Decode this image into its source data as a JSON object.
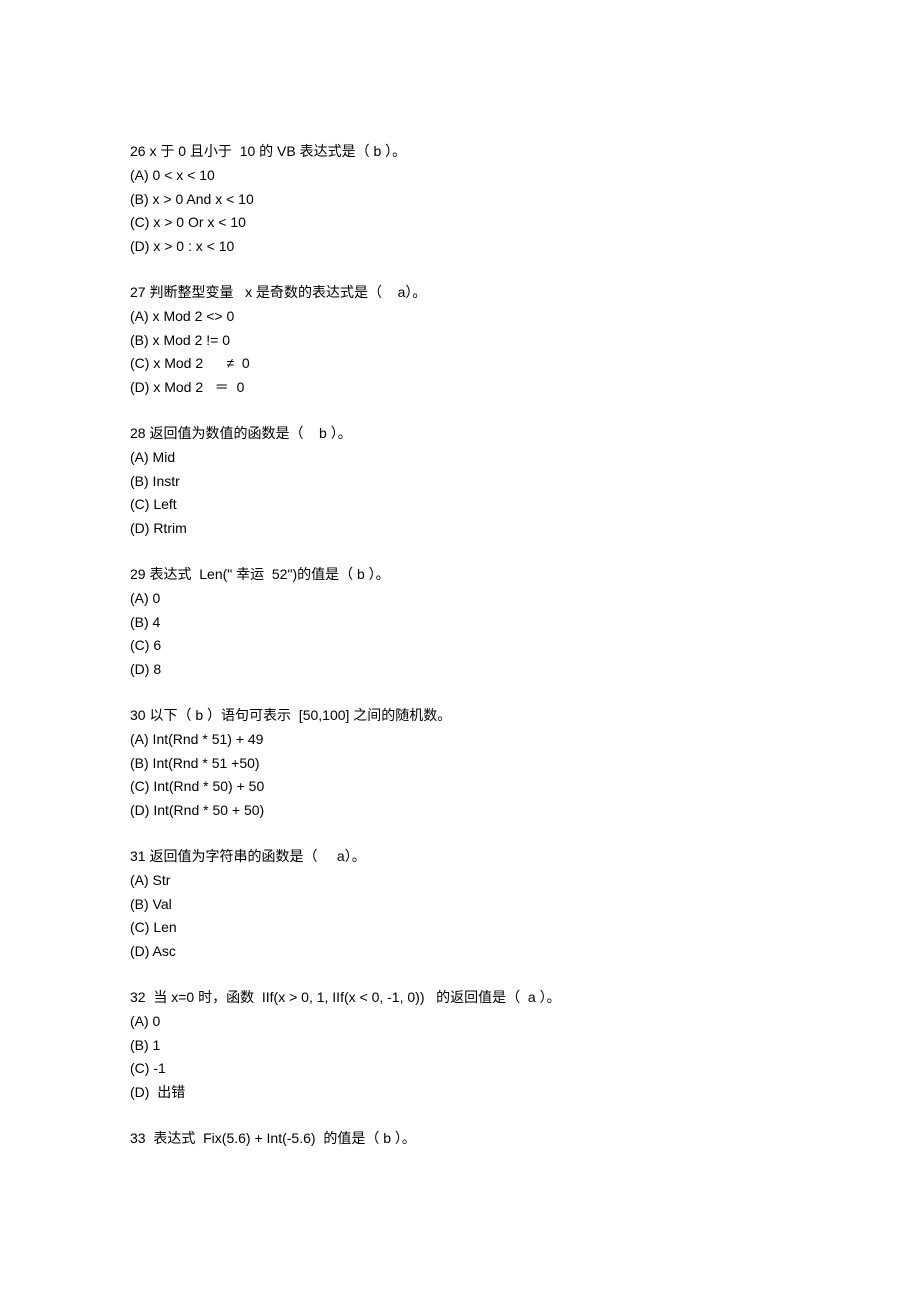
{
  "questions": [
    {
      "number": "26",
      "text": "26 x 于 0 且小于  10 的 VB 表达式是（ b ）。",
      "options": [
        "(A) 0 < x < 10",
        "(B) x > 0 And x < 10",
        "(C) x > 0 Or x < 10",
        "(D) x > 0 : x < 10"
      ]
    },
    {
      "number": "27",
      "text": "27 判断整型变量   x 是奇数的表达式是（    a）。",
      "options": [
        "(A) x Mod 2 <> 0",
        "(B) x Mod 2 != 0",
        "(C) x Mod 2      ≠  0",
        "(D) x Mod 2   ＝  0"
      ]
    },
    {
      "number": "28",
      "text": "28 返回值为数值的函数是（    b ）。",
      "options": [
        "(A) Mid",
        "(B) Instr",
        "(C) Left",
        "(D) Rtrim"
      ]
    },
    {
      "number": "29",
      "text": "29 表达式  Len(\" 幸运  52\")的值是（ b ）。",
      "options": [
        "(A) 0",
        "(B) 4",
        "(C) 6",
        "(D) 8"
      ]
    },
    {
      "number": "30",
      "text": "30 以下（ b ）语句可表示  [50,100] 之间的随机数。",
      "options": [
        "(A) Int(Rnd * 51) + 49",
        "(B) Int(Rnd * 51 +50)",
        "(C) Int(Rnd * 50) + 50",
        "(D) Int(Rnd * 50 + 50)"
      ]
    },
    {
      "number": "31",
      "text": "31 返回值为字符串的函数是（     a）。",
      "options": [
        "(A) Str",
        "(B) Val",
        "(C) Len",
        "(D) Asc"
      ]
    },
    {
      "number": "32",
      "text": "32  当 x=0 时，函数  IIf(x > 0, 1, IIf(x < 0, -1, 0))   的返回值是（  a ）。",
      "options": [
        "(A) 0",
        "(B) 1",
        "(C) -1",
        "(D)  出错"
      ]
    },
    {
      "number": "33",
      "text": "33  表达式  Fix(5.6) + Int(-5.6)  的值是（ b ）。",
      "options": []
    }
  ]
}
